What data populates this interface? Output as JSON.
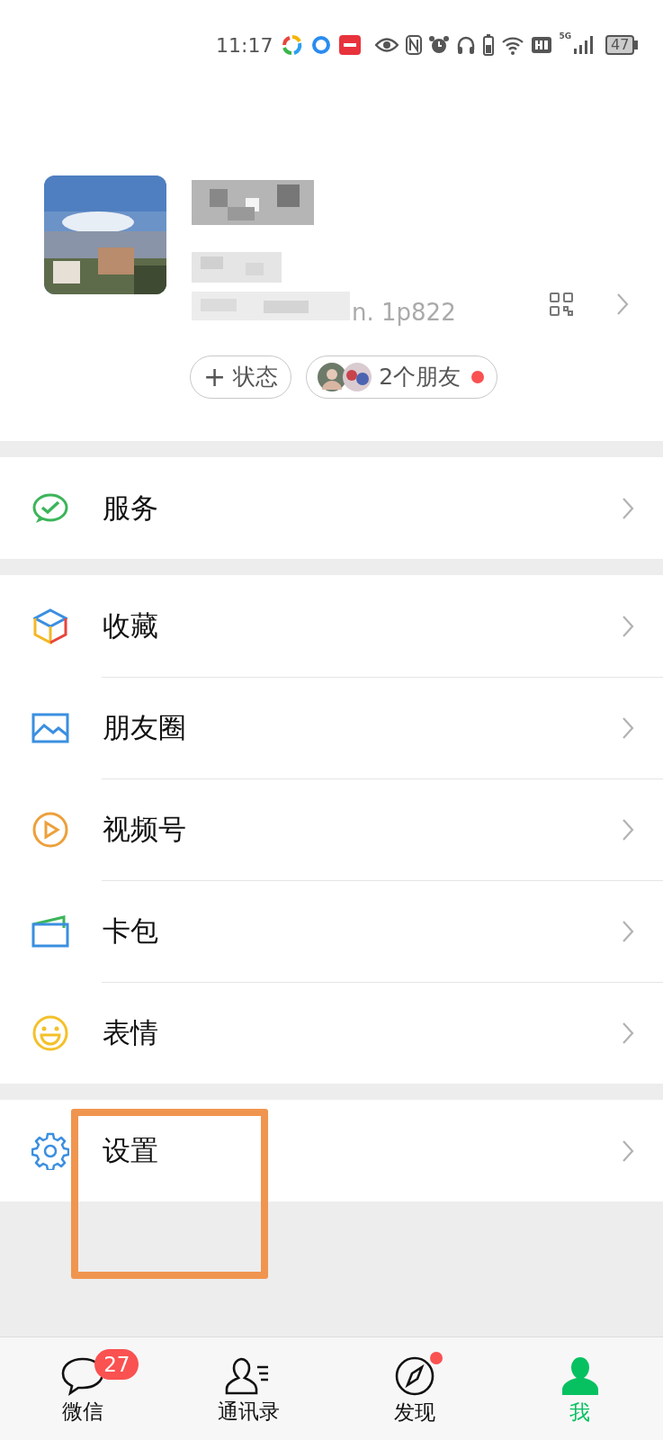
{
  "status_bar": {
    "time": "11:17",
    "battery": "47",
    "network": "5G"
  },
  "profile": {
    "id_tail": "n. 1p822",
    "buttons": [
      {
        "kind": "add",
        "icon_text": "+",
        "label": "状态"
      },
      {
        "kind": "friends",
        "label": "2个朋友",
        "dot": true
      }
    ]
  },
  "groups": [
    [
      {
        "kind": "service",
        "label": "服务"
      }
    ],
    [
      {
        "kind": "favorites",
        "label": "收藏"
      },
      {
        "kind": "moments",
        "label": "朋友圈"
      },
      {
        "kind": "channels",
        "label": "视频号"
      },
      {
        "kind": "cards",
        "label": "卡包"
      },
      {
        "kind": "stickers",
        "label": "表情"
      }
    ],
    [
      {
        "kind": "settings",
        "label": "设置"
      }
    ]
  ],
  "annotation": {
    "kind": "highlight",
    "color": "#f0954f"
  },
  "tabs": [
    {
      "kind": "chats",
      "label": "微信",
      "badge": "27",
      "dot": false,
      "selected": false
    },
    {
      "kind": "contacts",
      "label": "通讯录",
      "dot": false,
      "selected": false
    },
    {
      "kind": "discover",
      "label": "发现",
      "dot": true,
      "selected": false
    },
    {
      "kind": "me",
      "label": "我",
      "dot": false,
      "selected": true
    }
  ]
}
